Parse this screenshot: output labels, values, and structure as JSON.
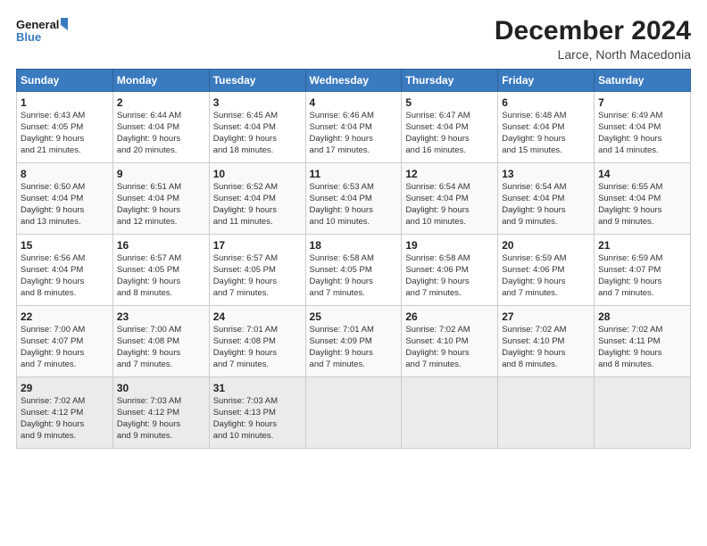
{
  "logo": {
    "line1": "General",
    "line2": "Blue"
  },
  "title": "December 2024",
  "location": "Larce, North Macedonia",
  "days_of_week": [
    "Sunday",
    "Monday",
    "Tuesday",
    "Wednesday",
    "Thursday",
    "Friday",
    "Saturday"
  ],
  "weeks": [
    [
      {
        "day": "1",
        "sunrise": "6:43 AM",
        "sunset": "4:05 PM",
        "daylight": "9 hours and 21 minutes."
      },
      {
        "day": "2",
        "sunrise": "6:44 AM",
        "sunset": "4:04 PM",
        "daylight": "9 hours and 20 minutes."
      },
      {
        "day": "3",
        "sunrise": "6:45 AM",
        "sunset": "4:04 PM",
        "daylight": "9 hours and 18 minutes."
      },
      {
        "day": "4",
        "sunrise": "6:46 AM",
        "sunset": "4:04 PM",
        "daylight": "9 hours and 17 minutes."
      },
      {
        "day": "5",
        "sunrise": "6:47 AM",
        "sunset": "4:04 PM",
        "daylight": "9 hours and 16 minutes."
      },
      {
        "day": "6",
        "sunrise": "6:48 AM",
        "sunset": "4:04 PM",
        "daylight": "9 hours and 15 minutes."
      },
      {
        "day": "7",
        "sunrise": "6:49 AM",
        "sunset": "4:04 PM",
        "daylight": "9 hours and 14 minutes."
      }
    ],
    [
      {
        "day": "8",
        "sunrise": "6:50 AM",
        "sunset": "4:04 PM",
        "daylight": "9 hours and 13 minutes."
      },
      {
        "day": "9",
        "sunrise": "6:51 AM",
        "sunset": "4:04 PM",
        "daylight": "9 hours and 12 minutes."
      },
      {
        "day": "10",
        "sunrise": "6:52 AM",
        "sunset": "4:04 PM",
        "daylight": "9 hours and 11 minutes."
      },
      {
        "day": "11",
        "sunrise": "6:53 AM",
        "sunset": "4:04 PM",
        "daylight": "9 hours and 10 minutes."
      },
      {
        "day": "12",
        "sunrise": "6:54 AM",
        "sunset": "4:04 PM",
        "daylight": "9 hours and 10 minutes."
      },
      {
        "day": "13",
        "sunrise": "6:54 AM",
        "sunset": "4:04 PM",
        "daylight": "9 hours and 9 minutes."
      },
      {
        "day": "14",
        "sunrise": "6:55 AM",
        "sunset": "4:04 PM",
        "daylight": "9 hours and 9 minutes."
      }
    ],
    [
      {
        "day": "15",
        "sunrise": "6:56 AM",
        "sunset": "4:04 PM",
        "daylight": "9 hours and 8 minutes."
      },
      {
        "day": "16",
        "sunrise": "6:57 AM",
        "sunset": "4:05 PM",
        "daylight": "9 hours and 8 minutes."
      },
      {
        "day": "17",
        "sunrise": "6:57 AM",
        "sunset": "4:05 PM",
        "daylight": "9 hours and 7 minutes."
      },
      {
        "day": "18",
        "sunrise": "6:58 AM",
        "sunset": "4:05 PM",
        "daylight": "9 hours and 7 minutes."
      },
      {
        "day": "19",
        "sunrise": "6:58 AM",
        "sunset": "4:06 PM",
        "daylight": "9 hours and 7 minutes."
      },
      {
        "day": "20",
        "sunrise": "6:59 AM",
        "sunset": "4:06 PM",
        "daylight": "9 hours and 7 minutes."
      },
      {
        "day": "21",
        "sunrise": "6:59 AM",
        "sunset": "4:07 PM",
        "daylight": "9 hours and 7 minutes."
      }
    ],
    [
      {
        "day": "22",
        "sunrise": "7:00 AM",
        "sunset": "4:07 PM",
        "daylight": "9 hours and 7 minutes."
      },
      {
        "day": "23",
        "sunrise": "7:00 AM",
        "sunset": "4:08 PM",
        "daylight": "9 hours and 7 minutes."
      },
      {
        "day": "24",
        "sunrise": "7:01 AM",
        "sunset": "4:08 PM",
        "daylight": "9 hours and 7 minutes."
      },
      {
        "day": "25",
        "sunrise": "7:01 AM",
        "sunset": "4:09 PM",
        "daylight": "9 hours and 7 minutes."
      },
      {
        "day": "26",
        "sunrise": "7:02 AM",
        "sunset": "4:10 PM",
        "daylight": "9 hours and 7 minutes."
      },
      {
        "day": "27",
        "sunrise": "7:02 AM",
        "sunset": "4:10 PM",
        "daylight": "9 hours and 8 minutes."
      },
      {
        "day": "28",
        "sunrise": "7:02 AM",
        "sunset": "4:11 PM",
        "daylight": "9 hours and 8 minutes."
      }
    ],
    [
      {
        "day": "29",
        "sunrise": "7:02 AM",
        "sunset": "4:12 PM",
        "daylight": "9 hours and 9 minutes."
      },
      {
        "day": "30",
        "sunrise": "7:03 AM",
        "sunset": "4:12 PM",
        "daylight": "9 hours and 9 minutes."
      },
      {
        "day": "31",
        "sunrise": "7:03 AM",
        "sunset": "4:13 PM",
        "daylight": "9 hours and 10 minutes."
      },
      null,
      null,
      null,
      null
    ]
  ],
  "labels": {
    "sunrise": "Sunrise:",
    "sunset": "Sunset:",
    "daylight": "Daylight hours"
  }
}
